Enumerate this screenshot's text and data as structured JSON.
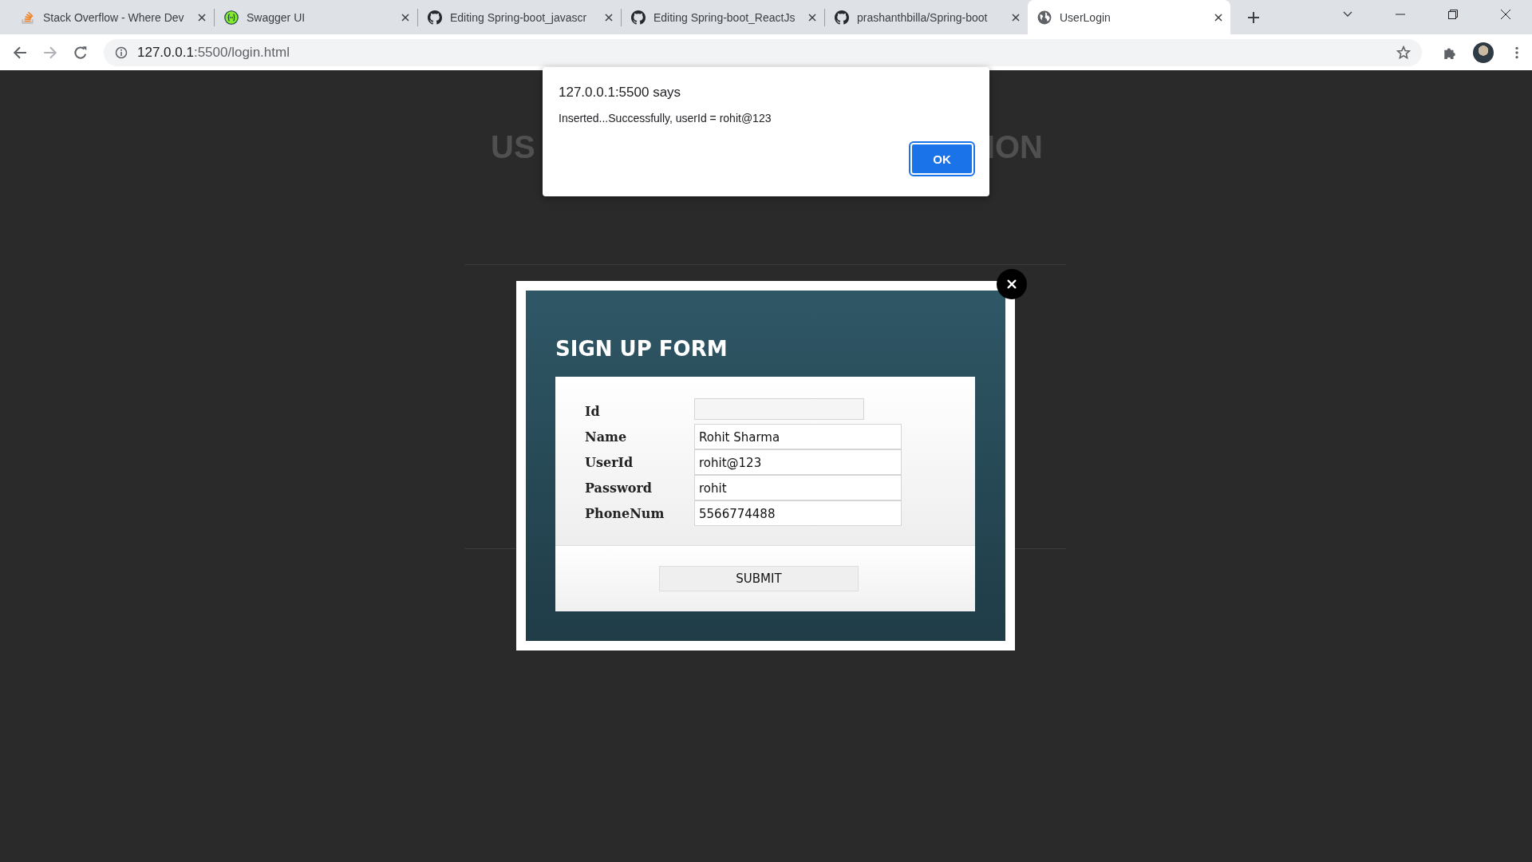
{
  "tabs": [
    {
      "title": "Stack Overflow - Where Dev",
      "kind": "stack",
      "selected": false
    },
    {
      "title": "Swagger UI",
      "kind": "swagger",
      "selected": false
    },
    {
      "title": "Editing Spring-boot_javascr",
      "kind": "github",
      "selected": false
    },
    {
      "title": "Editing Spring-boot_ReactJs",
      "kind": "github",
      "selected": false
    },
    {
      "title": "prashanthbilla/Spring-boot",
      "kind": "github",
      "selected": false
    },
    {
      "title": "UserLogin",
      "kind": "globe",
      "selected": true
    }
  ],
  "address_bar": {
    "host": "127.0.0.1",
    "rest": ":5500/login.html"
  },
  "page": {
    "heading_left": "US",
    "heading_right": "ION"
  },
  "alert": {
    "title": "127.0.0.1:5500 says",
    "message": "Inserted...Successfully, userId = rohit@123",
    "button": "OK"
  },
  "signup": {
    "title": "SIGN UP FORM",
    "fields": [
      {
        "label": "Id",
        "disabled": true
      },
      {
        "label": "Name",
        "value": "Rohit Sharma",
        "disabled": false
      },
      {
        "label": "UserId",
        "value": "rohit@123",
        "disabled": false
      },
      {
        "label": "Password",
        "value": "rohit",
        "disabled": false
      },
      {
        "label": "PhoneNum",
        "value": "5566774488",
        "disabled": false
      }
    ],
    "submit": "SUBMIT"
  }
}
